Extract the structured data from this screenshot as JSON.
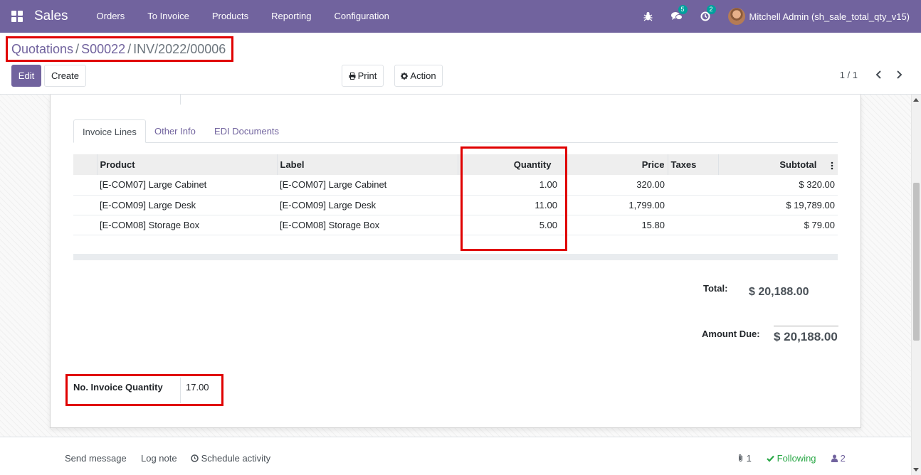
{
  "navbar": {
    "app_name": "Sales",
    "menu": [
      "Orders",
      "To Invoice",
      "Products",
      "Reporting",
      "Configuration"
    ],
    "messages_count": "5",
    "activities_count": "2",
    "user_name": "Mitchell Admin (sh_sale_total_qty_v15)"
  },
  "breadcrumb": {
    "items": [
      "Quotations",
      "S00022"
    ],
    "current": "INV/2022/00006",
    "separator": "/"
  },
  "buttons": {
    "edit": "Edit",
    "create": "Create",
    "print": "Print",
    "action": "Action"
  },
  "pager": {
    "value": "1 / 1"
  },
  "tabs": [
    "Invoice Lines",
    "Other Info",
    "EDI Documents"
  ],
  "invoice_lines": {
    "columns": {
      "product": "Product",
      "label": "Label",
      "quantity": "Quantity",
      "price": "Price",
      "taxes": "Taxes",
      "subtotal": "Subtotal"
    },
    "rows": [
      {
        "product": "[E-COM07] Large Cabinet",
        "label": "[E-COM07] Large Cabinet",
        "quantity": "1.00",
        "price": "320.00",
        "taxes": "",
        "subtotal": "$ 320.00"
      },
      {
        "product": "[E-COM09] Large Desk",
        "label": "[E-COM09] Large Desk",
        "quantity": "11.00",
        "price": "1,799.00",
        "taxes": "",
        "subtotal": "$ 19,789.00"
      },
      {
        "product": "[E-COM08] Storage Box",
        "label": "[E-COM08] Storage Box",
        "quantity": "5.00",
        "price": "15.80",
        "taxes": "",
        "subtotal": "$ 79.00"
      }
    ]
  },
  "totals": {
    "total_label": "Total:",
    "total_value": "$ 20,188.00",
    "amount_due_label": "Amount Due:",
    "amount_due_value": "$ 20,188.00"
  },
  "invoice_quantity": {
    "label": "No. Invoice Quantity",
    "value": "17.00"
  },
  "chatter": {
    "send_message": "Send message",
    "log_note": "Log note",
    "schedule_activity": "Schedule activity",
    "attachments_count": "1",
    "following": "Following",
    "followers_count": "2"
  },
  "colors": {
    "brand": "#71639e",
    "highlight": "#e00000",
    "following": "#28a745",
    "badge": "#00a09d"
  }
}
